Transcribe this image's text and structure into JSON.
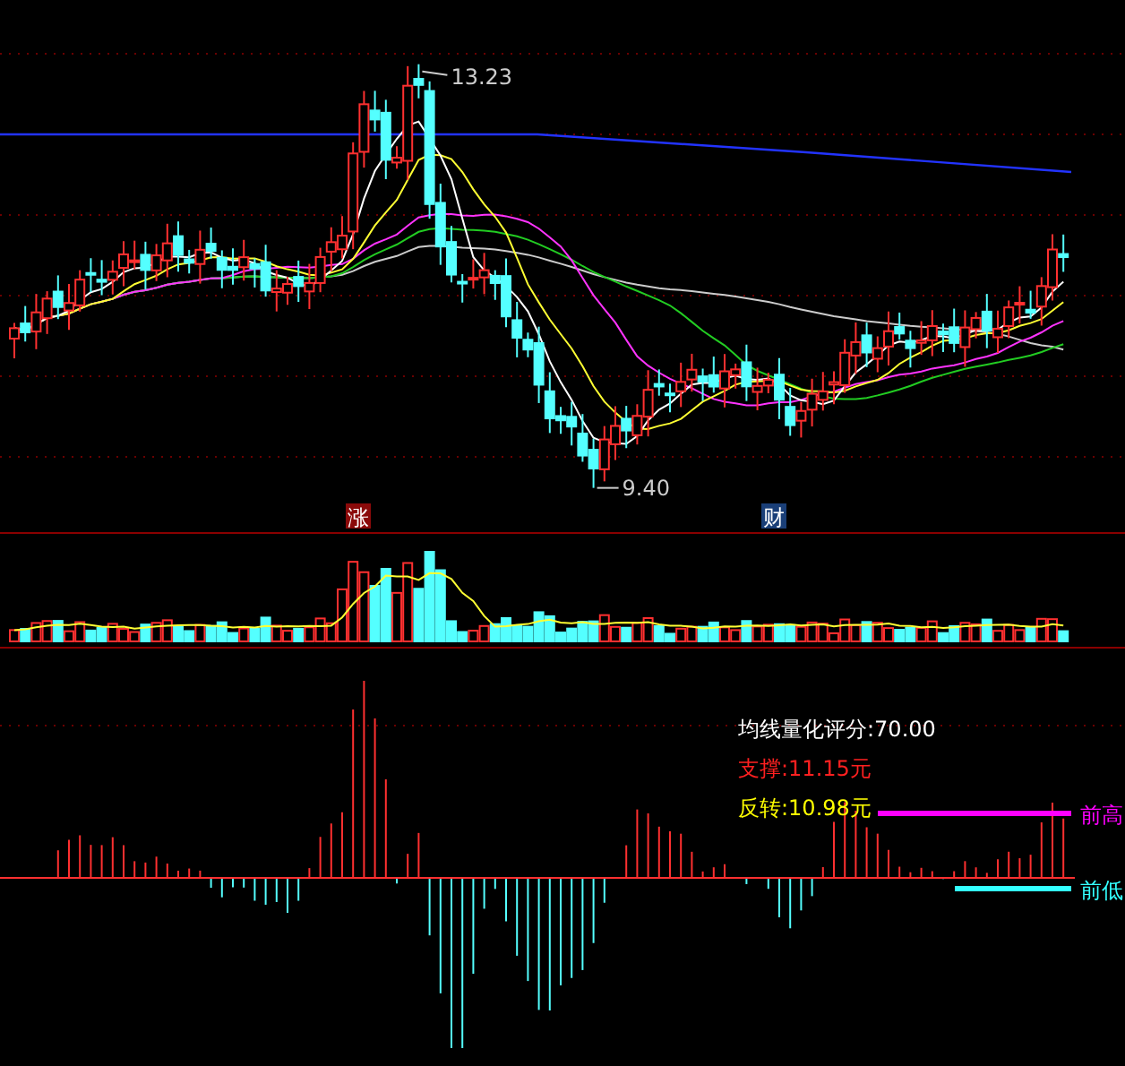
{
  "price_chart": {
    "high_label": "13.23",
    "low_label": "9.40",
    "markers": [
      {
        "text": "涨",
        "color": "#8b0a0a"
      },
      {
        "text": "财",
        "color": "#1a3f78"
      }
    ]
  },
  "indicator": {
    "readouts": [
      {
        "text": "均线量化评分:70.00",
        "color": "#ffffff"
      },
      {
        "text": "支撑:11.15元",
        "color": "#ff2020"
      },
      {
        "text": "反转:10.98元",
        "color": "#ffff00"
      }
    ],
    "levels": [
      {
        "label": "前高",
        "color": "#ff00ff"
      },
      {
        "label": "前低",
        "color": "#33ffff"
      }
    ]
  }
}
